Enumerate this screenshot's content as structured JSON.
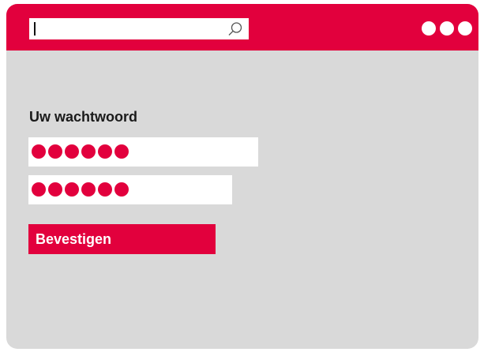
{
  "titlebar": {
    "search": {
      "value": "",
      "icon": "search-icon"
    },
    "menu_icon": "more-dots-icon",
    "accent_color": "#e2003d"
  },
  "form": {
    "label": "Uw wachtwoord",
    "password_field": {
      "masked_length": 6
    },
    "confirm_field": {
      "masked_length": 6
    },
    "confirm_button_label": "Bevestigen"
  }
}
